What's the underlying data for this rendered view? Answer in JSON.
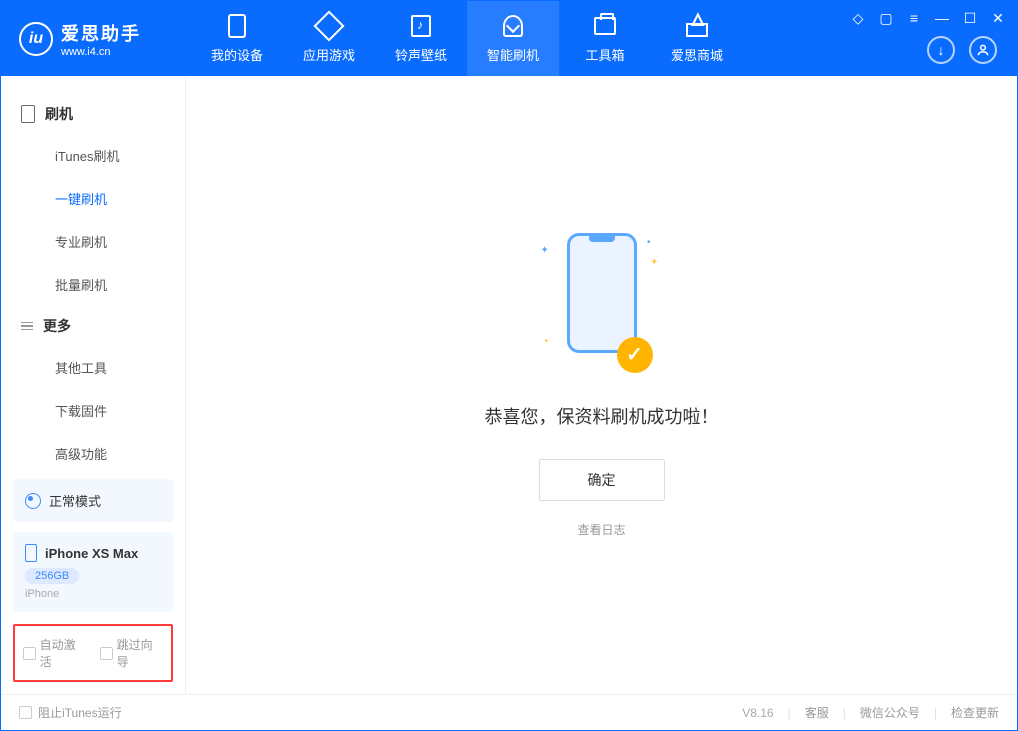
{
  "logo": {
    "title": "爱思助手",
    "sub": "www.i4.cn",
    "badge": "iu"
  },
  "nav": [
    {
      "label": "我的设备",
      "icon": "device-icon"
    },
    {
      "label": "应用游戏",
      "icon": "cube-icon"
    },
    {
      "label": "铃声壁纸",
      "icon": "music-icon"
    },
    {
      "label": "智能刷机",
      "icon": "shield-icon",
      "active": true
    },
    {
      "label": "工具箱",
      "icon": "toolbox-icon"
    },
    {
      "label": "爱思商城",
      "icon": "store-icon"
    }
  ],
  "sidebar": {
    "section1_title": "刷机",
    "items1": [
      {
        "label": "iTunes刷机"
      },
      {
        "label": "一键刷机",
        "active": true
      },
      {
        "label": "专业刷机"
      },
      {
        "label": "批量刷机"
      }
    ],
    "section2_title": "更多",
    "items2": [
      {
        "label": "其他工具"
      },
      {
        "label": "下载固件"
      },
      {
        "label": "高级功能"
      }
    ]
  },
  "device_status": {
    "label": "正常模式"
  },
  "device": {
    "name": "iPhone XS Max",
    "capacity": "256GB",
    "type": "iPhone"
  },
  "checkboxes": {
    "auto_activate": "自动激活",
    "skip_guide": "跳过向导"
  },
  "main": {
    "success_text": "恭喜您，保资料刷机成功啦！",
    "ok_button": "确定",
    "view_log": "查看日志"
  },
  "footer": {
    "stop_itunes": "阻止iTunes运行",
    "version": "V8.16",
    "customer_service": "客服",
    "wechat": "微信公众号",
    "check_update": "检查更新"
  }
}
